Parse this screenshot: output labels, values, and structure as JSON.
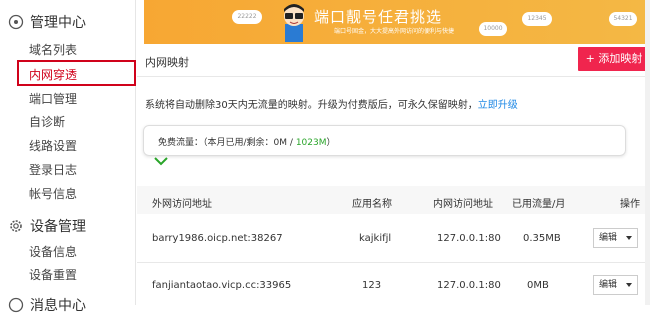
{
  "sidebar": {
    "sections": [
      {
        "title": "管理中心",
        "icon": "home-icon",
        "items": [
          "域名列表",
          "内网穿透",
          "端口管理",
          "自诊断",
          "线路设置",
          "登录日志",
          "帐号信息"
        ]
      },
      {
        "title": "设备管理",
        "icon": "gear-icon",
        "items": [
          "设备信息",
          "设备重置"
        ]
      },
      {
        "title": "消息中心",
        "icon": "message-icon",
        "items": []
      }
    ],
    "active_item": "内网穿透"
  },
  "banner": {
    "title": "端口靓号任君挑选",
    "subtitle": "端口号固金，大大提高外网访问的便利与快捷",
    "clouds": [
      "22222",
      "12345",
      "10000",
      "54321"
    ]
  },
  "page": {
    "title": "内网映射",
    "add_button": "+ 添加映射",
    "notice_text": "系统将自动删除30天内无流量的映射。升级为付费版后，可永久保留映射，",
    "notice_link": "立即升级"
  },
  "flow": {
    "label": "免费流量：（本月已用/剩余：",
    "used": "0M",
    "separator": " / ",
    "remaining": "1023M",
    "end": "）"
  },
  "table": {
    "headers": [
      "外网访问地址",
      "应用名称",
      "内网访问地址",
      "已用流量/月",
      "操作"
    ],
    "rows": [
      {
        "external": "barry1986.oicp.net:38267",
        "app": "kajkifjl",
        "internal": "127.0.0.1:80",
        "traffic": "0.35MB",
        "action": "编辑"
      },
      {
        "external": "fanjiantaotao.vicp.cc:33965",
        "app": "123",
        "internal": "127.0.0.1:80",
        "traffic": "0MB",
        "action": "编辑"
      }
    ]
  },
  "colors": {
    "accent": "#f0254e",
    "active": "#d0021b",
    "link": "#1e88e5",
    "green": "#2aa52a",
    "banner": "#f7a733"
  }
}
